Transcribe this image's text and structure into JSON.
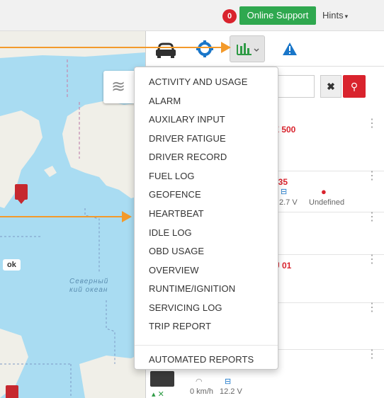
{
  "header": {
    "notification_count": "0",
    "support_label": "Online Support",
    "hints_label": "Hints"
  },
  "map": {
    "city_label": "ok",
    "sea_label": "Северный\nкий океан"
  },
  "panel": {
    "tabs": [
      {
        "name": "vehicles",
        "icon": "car-icon"
      },
      {
        "name": "settings",
        "icon": "gear-icon"
      },
      {
        "name": "reports",
        "icon": "bar-chart-icon"
      },
      {
        "name": "alerts",
        "icon": "warning-icon"
      }
    ],
    "vehicles": [
      {
        "name": "E 500"
      },
      {
        "name": "735",
        "voltage": "2.7 V",
        "driver": "Undefined"
      },
      {
        "name": ""
      },
      {
        "name": "U 01"
      },
      {
        "name": ""
      },
      {
        "name": "",
        "speed": "0 km/h",
        "voltage": "12.2 V"
      }
    ]
  },
  "reports_menu": {
    "items": [
      "ACTIVITY AND USAGE",
      "ALARM",
      "AUXILARY INPUT",
      "DRIVER FATIGUE",
      "DRIVER RECORD",
      "FUEL LOG",
      "GEOFENCE",
      "HEARTBEAT",
      "IDLE LOG",
      "OBD USAGE",
      "OVERVIEW",
      "RUNTIME/IGNITION",
      "SERVICING LOG",
      "TRIP REPORT"
    ],
    "footer_item": "AUTOMATED REPORTS"
  },
  "colors": {
    "accent_red": "#d9232d",
    "support_green": "#2fa84f",
    "callout_orange": "#f39a2b",
    "map_water": "#a9dcf2",
    "map_land": "#f0efe8"
  }
}
